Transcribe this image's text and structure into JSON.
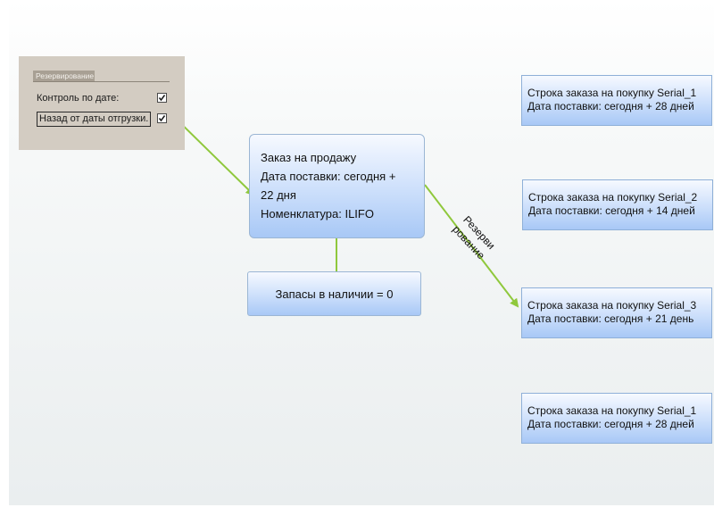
{
  "reservation_panel": {
    "tab_label": "Резервирование",
    "date_control_label": "Контроль по дате:",
    "date_control_checked": true,
    "backward_label": "Назад от даты отгрузки.",
    "backward_checked": true
  },
  "sales_order": {
    "line1": "Заказ на продажу",
    "line2": "Дата поставки: сегодня +",
    "line3": "22 дня",
    "line4": "Номенклатура: ILIFO"
  },
  "stock": {
    "label": "Запасы в наличии = 0"
  },
  "reservation_arrow_label": {
    "line1": "Резерви",
    "line2": "рование"
  },
  "purchase_lines": [
    {
      "title": "Строка заказа на покупку Serial_1",
      "delivery": "Дата поставки: сегодня + 28 дней"
    },
    {
      "title": "Строка заказа на покупку Serial_2",
      "delivery": "Дата поставки: сегодня + 14 дней"
    },
    {
      "title": "Строка заказа на покупку Serial_3",
      "delivery": "Дата поставки: сегодня + 21 день"
    },
    {
      "title": "Строка заказа на покупку Serial_1",
      "delivery": "Дата поставки: сегодня + 28 дней"
    }
  ],
  "colors": {
    "arrow": "#8fc83c",
    "box_top": "#f6f9ff",
    "box_bottom": "#a8c8f6",
    "panel": "#d3ccc2"
  }
}
